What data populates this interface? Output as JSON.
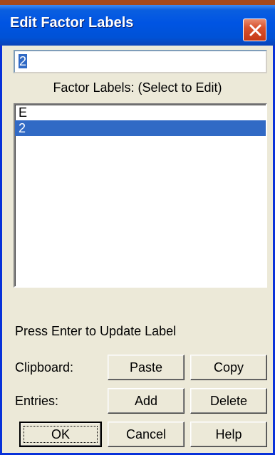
{
  "window": {
    "title": "Edit Factor Labels"
  },
  "edit": {
    "value": "2"
  },
  "list": {
    "label": "Factor Labels: (Select to Edit)",
    "items": [
      "E",
      "2"
    ],
    "selected_index": 1
  },
  "hint": "Press Enter to Update Label",
  "clipboard": {
    "label": "Clipboard:",
    "paste": "Paste",
    "copy": "Copy"
  },
  "entries": {
    "label": "Entries:",
    "add": "Add",
    "delete": "Delete"
  },
  "footer": {
    "ok": "OK",
    "cancel": "Cancel",
    "help": "Help"
  },
  "icons": {
    "close": "close-icon"
  },
  "colors": {
    "title_bar": "#0054e3",
    "selection": "#316ac5",
    "close_button": "#d8522d"
  }
}
